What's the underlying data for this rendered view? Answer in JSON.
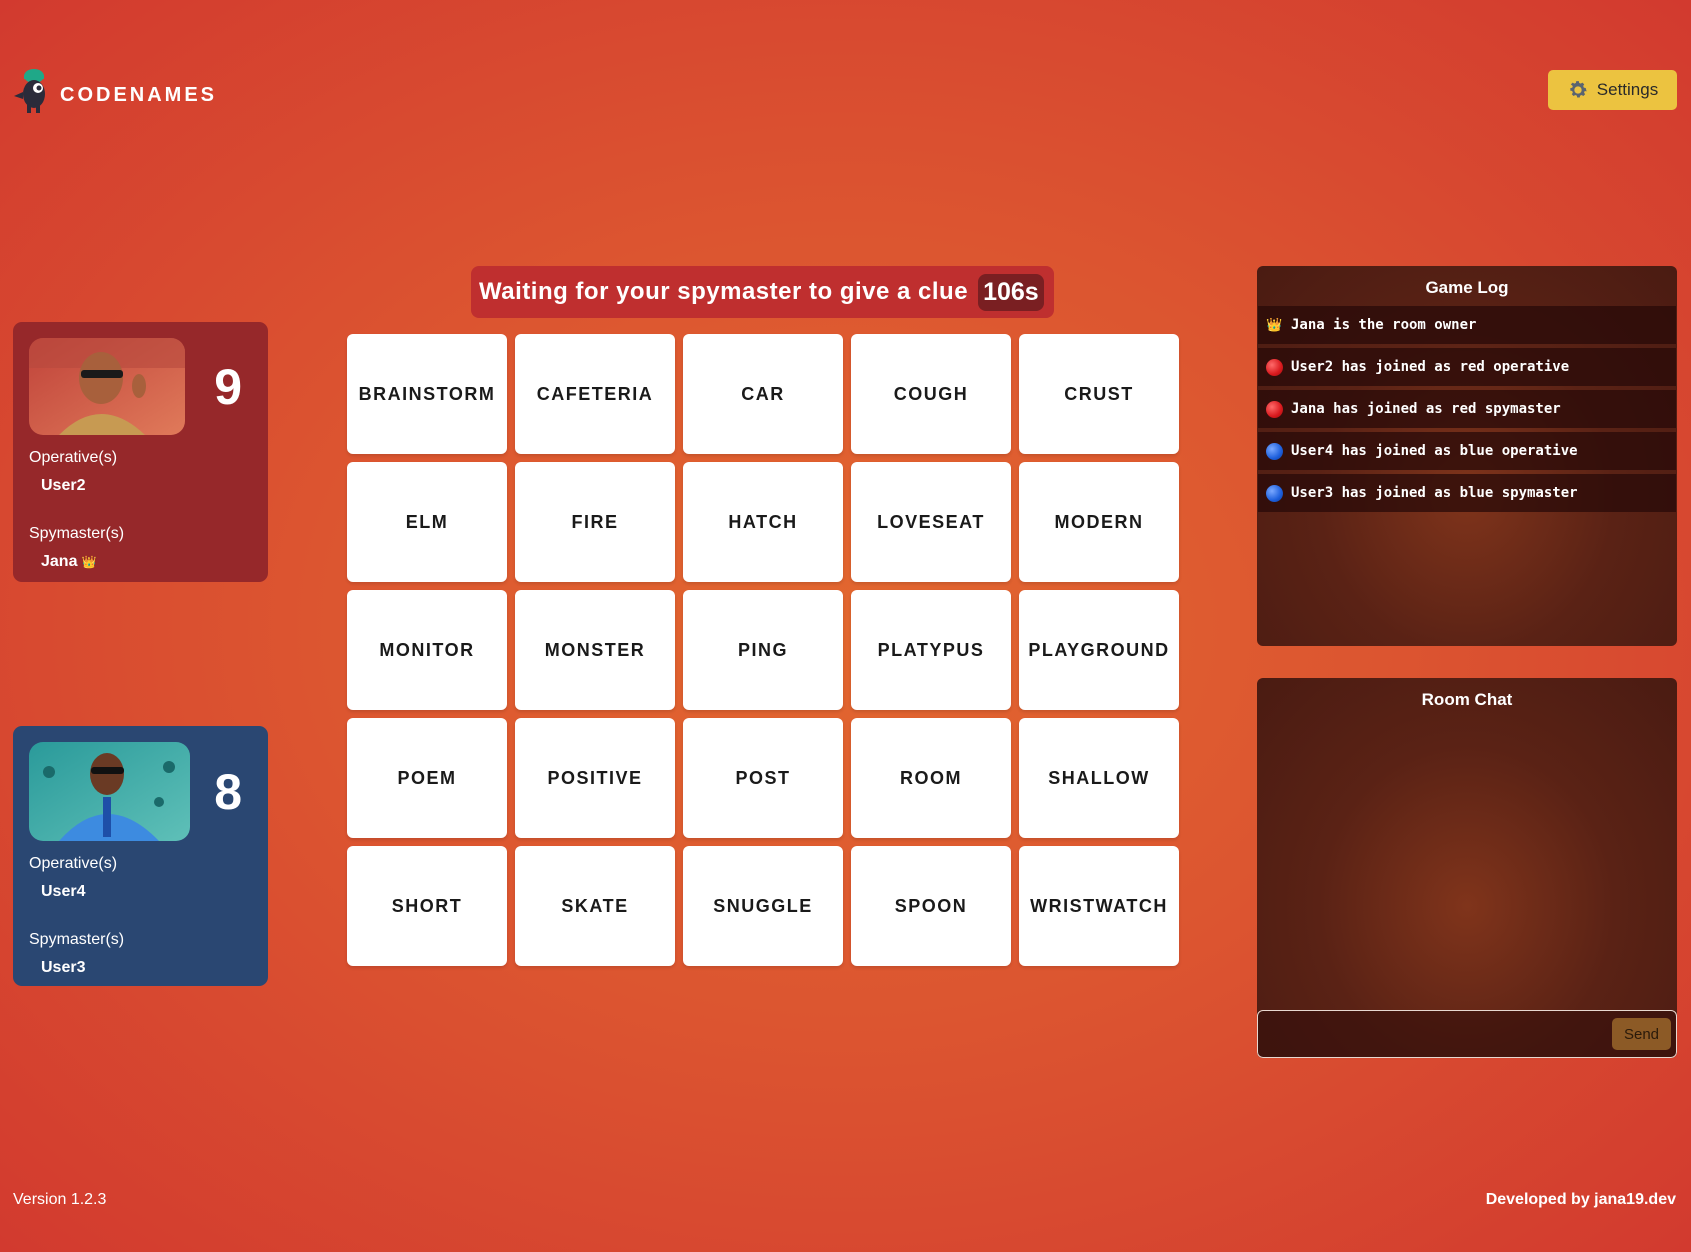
{
  "header": {
    "logo_text": "CODENAMES",
    "settings_label": "Settings"
  },
  "red_team": {
    "count": "9",
    "operative_label": "Operative(s)",
    "operative": "User2",
    "spymaster_label": "Spymaster(s)",
    "spymaster": "Jana",
    "owner_badge": "👑"
  },
  "blue_team": {
    "count": "8",
    "operative_label": "Operative(s)",
    "operative": "User4",
    "spymaster_label": "Spymaster(s)",
    "spymaster": "User3"
  },
  "clue": {
    "text": "Waiting for your spymaster to give a clue",
    "timer": "106s"
  },
  "board": {
    "cards": [
      "BRAINSTORM",
      "CAFETERIA",
      "CAR",
      "COUGH",
      "CRUST",
      "ELM",
      "FIRE",
      "HATCH",
      "LOVESEAT",
      "MODERN",
      "MONITOR",
      "MONSTER",
      "PING",
      "PLATYPUS",
      "PLAYGROUND",
      "POEM",
      "POSITIVE",
      "POST",
      "ROOM",
      "SHALLOW",
      "SHORT",
      "SKATE",
      "SNUGGLE",
      "SPOON",
      "WRISTWATCH"
    ]
  },
  "game_log": {
    "title": "Game Log",
    "entries": [
      {
        "icon": "crown",
        "text": "Jana is the room owner"
      },
      {
        "icon": "red-dot",
        "text": "User2 has joined as red operative"
      },
      {
        "icon": "red-dot",
        "text": "Jana has joined as red spymaster"
      },
      {
        "icon": "blue-dot",
        "text": "User4 has joined as blue operative"
      },
      {
        "icon": "blue-dot",
        "text": "User3 has joined as blue spymaster"
      }
    ]
  },
  "chat": {
    "title": "Room Chat",
    "input_value": "",
    "send_label": "Send"
  },
  "footer": {
    "version": "Version 1.2.3",
    "credit": "Developed by jana19.dev"
  },
  "colors": {
    "red_team": "#96282a",
    "blue_team": "#2a4772",
    "settings_button": "#ecc340",
    "clue_banner": "#bf2f2f"
  }
}
